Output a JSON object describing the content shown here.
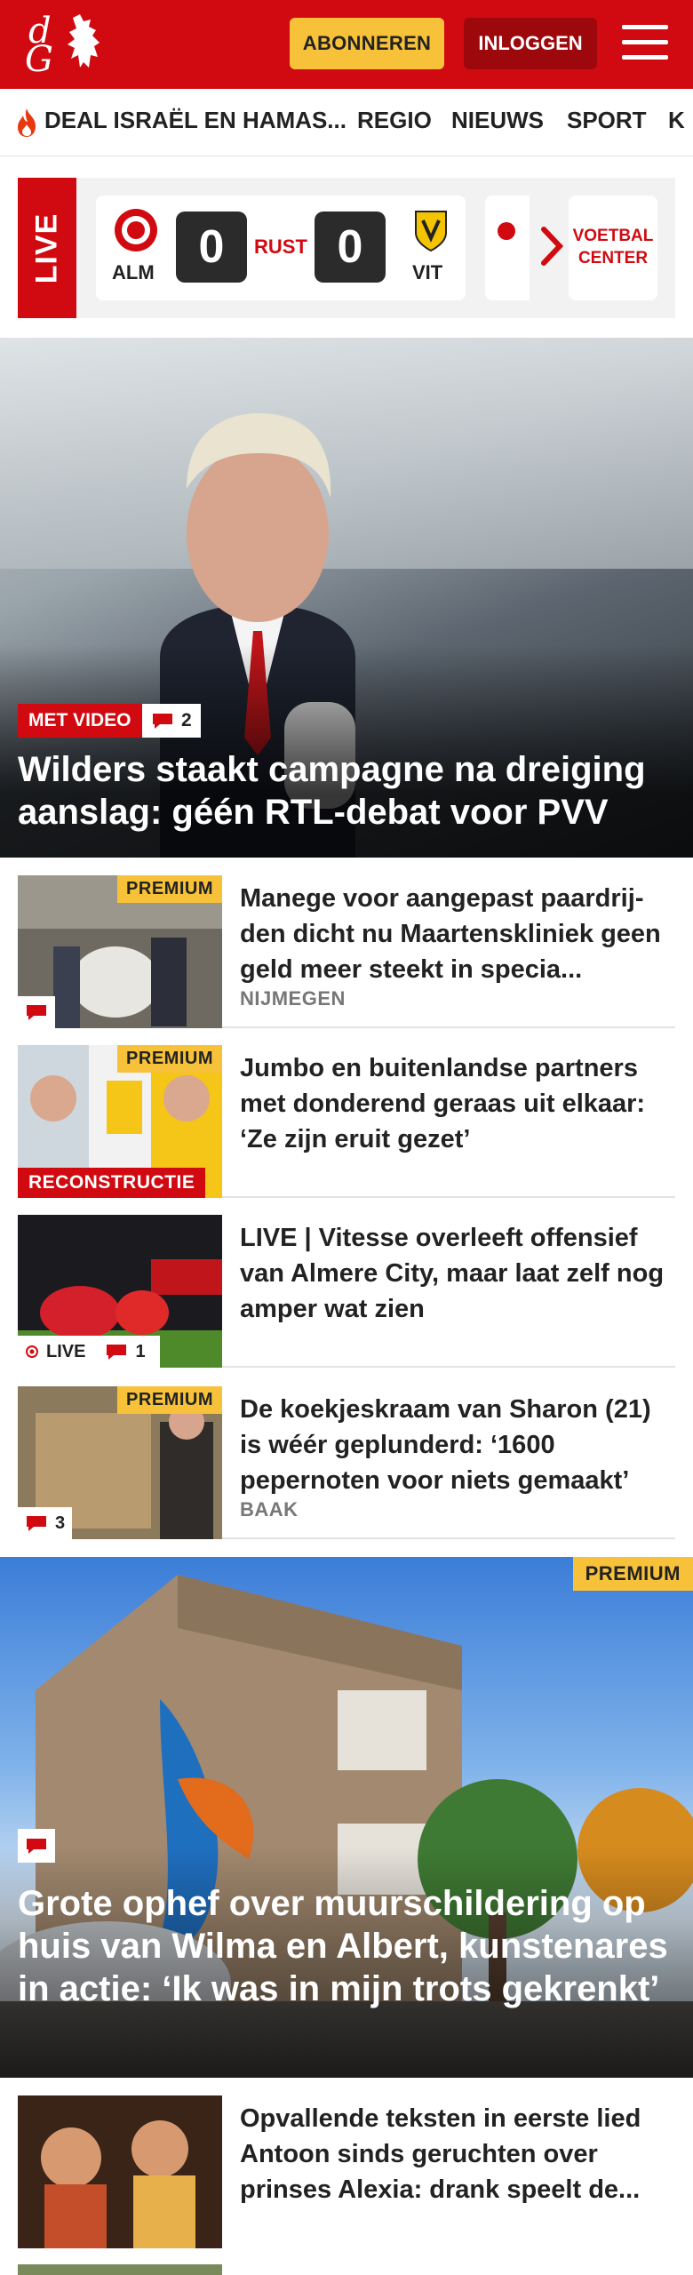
{
  "header": {
    "subscribe_label": "ABONNEREN",
    "login_label": "INLOGGEN"
  },
  "nav": {
    "items": [
      "DEAL ISRAËL EN HAMAS...",
      "REGIO",
      "NIEUWS",
      "SPORT",
      "K"
    ]
  },
  "live": {
    "tag": "LIVE",
    "match": {
      "home": "ALM",
      "away": "VIT",
      "home_score": "0",
      "away_score": "0",
      "status": "RUST"
    },
    "voetbal_center": "VOETBAL CENTER"
  },
  "hero": {
    "badge": "MET VIDEO",
    "comments": "2",
    "title": "Wilders staakt campagne na dreiging aanslag: géén RTL-debat voor PVV"
  },
  "articles": [
    {
      "title": "Manege voor aangepast paardrij­den dicht nu Maartenskliniek geen geld meer steekt in specia...",
      "place": "NIJMEGEN",
      "premium": "PREMIUM"
    },
    {
      "title": "Jumbo en buitenlandse partners met donderend geraas uit elkaar: ‘Ze zijn eruit gezet’",
      "premium": "PREMIUM",
      "label": "RECONSTRUCTIE"
    },
    {
      "title": "LIVE | Vitesse overleeft offensief van Almere City, maar laat zelf nog amper wat zien",
      "live_label": "LIVE",
      "comments": "1"
    },
    {
      "title": "De koekjeskraam van Sharon (21) is wéér geplunderd: ‘1600 pepernoten voor niets gemaakt’",
      "place": "BAAK",
      "premium": "PREMIUM",
      "comments": "3"
    }
  ],
  "feature": {
    "premium": "PREMIUM",
    "title": "Grote ophef over muurschildering op huis van Wilma en Albert, kunstena­res in actie: ‘Ik was in mijn trots gekrenkt’"
  },
  "articles2": [
    {
      "title": "Opvallende teksten in eerste lied Antoon sinds geruchten over prinses Alexia: drank speelt de..."
    }
  ],
  "colors": {
    "brand_red": "#d10a11",
    "premium_yellow": "#f7c23a"
  }
}
